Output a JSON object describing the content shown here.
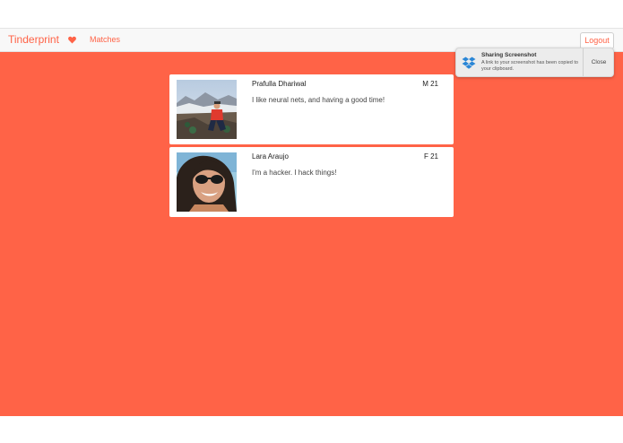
{
  "navbar": {
    "brand": "Tinderprint",
    "heart_icon": "heart-icon",
    "matches_label": "Matches",
    "logout_label": "Logout"
  },
  "colors": {
    "accent": "#ff6347",
    "navbar_bg": "#f8f8f8",
    "card_bg": "#ffffff"
  },
  "matches": [
    {
      "name": "Prafulla Dhariwal",
      "meta": "M 21",
      "bio": "I like neural nets, and having a good time!",
      "photo_icon": "profile-photo-mountain"
    },
    {
      "name": "Lara Araujo",
      "meta": "F 21",
      "bio": "I'm a hacker. I hack things!",
      "photo_icon": "profile-photo-selfie"
    }
  ],
  "notification": {
    "icon": "dropbox-icon",
    "title": "Sharing Screenshot",
    "text": "A link to your screenshot has been copied to your clipboard.",
    "close_label": "Close"
  }
}
